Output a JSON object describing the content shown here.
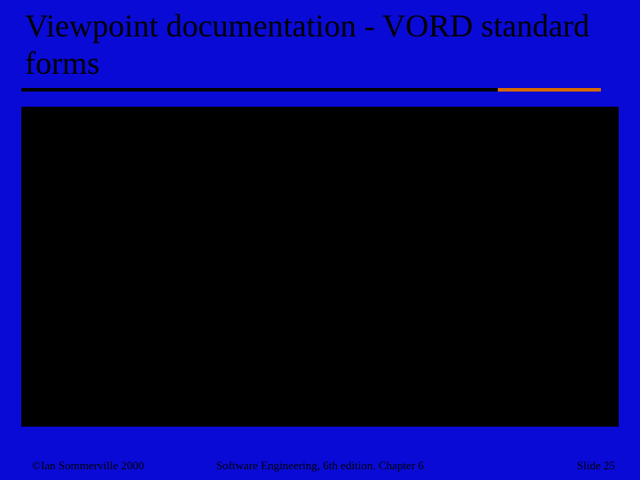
{
  "slide": {
    "title": "Viewpoint documentation - VORD standard forms"
  },
  "footer": {
    "left": "©Ian Sommerville 2000",
    "center": "Software Engineering, 6th edition. Chapter 6",
    "right": "Slide 25"
  }
}
